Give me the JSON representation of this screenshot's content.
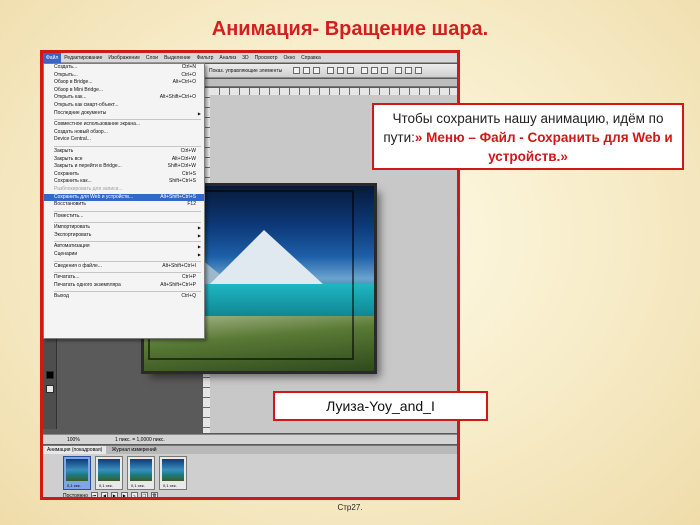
{
  "slide": {
    "title": "Анимация- Вращение шара.",
    "page_number": "Стр27."
  },
  "colors": {
    "accent": "#d01818",
    "menu_highlight": "#3368c8"
  },
  "photoshop": {
    "menubar": [
      "Файл",
      "Редактирование",
      "Изображение",
      "Слои",
      "Выделение",
      "Фильтр",
      "Анализ",
      "3D",
      "Просмотр",
      "Окно",
      "Справка"
    ],
    "options_label": "Показ. управляющие элементы",
    "file_menu": [
      {
        "label": "Создать...",
        "shortcut": "Ctrl+N"
      },
      {
        "label": "Открыть...",
        "shortcut": "Ctrl+O"
      },
      {
        "label": "Обзор в Bridge...",
        "shortcut": "Alt+Ctrl+O"
      },
      {
        "label": "Обзор в Mini Bridge...",
        "shortcut": ""
      },
      {
        "label": "Открыть как...",
        "shortcut": "Alt+Shift+Ctrl+O"
      },
      {
        "label": "Открыть как смарт-объект...",
        "shortcut": ""
      },
      {
        "label": "Последние документы",
        "shortcut": "",
        "submenu": true
      },
      {
        "separator": true
      },
      {
        "label": "Совместное использование экрана...",
        "shortcut": ""
      },
      {
        "label": "Создать новый обзор...",
        "shortcut": ""
      },
      {
        "label": "Device Central...",
        "shortcut": ""
      },
      {
        "separator": true
      },
      {
        "label": "Закрыть",
        "shortcut": "Ctrl+W"
      },
      {
        "label": "Закрыть все",
        "shortcut": "Alt+Ctrl+W"
      },
      {
        "label": "Закрыть и перейти в Bridge...",
        "shortcut": "Shift+Ctrl+W"
      },
      {
        "label": "Сохранить",
        "shortcut": "Ctrl+S"
      },
      {
        "label": "Сохранить как...",
        "shortcut": "Shift+Ctrl+S"
      },
      {
        "label": "Разблокировать для записи...",
        "shortcut": "",
        "disabled": true
      },
      {
        "label": "Сохранить для Web и устройств...",
        "shortcut": "Alt+Shift+Ctrl+S",
        "highlight": true
      },
      {
        "label": "Восстановить",
        "shortcut": "F12"
      },
      {
        "separator": true
      },
      {
        "label": "Поместить...",
        "shortcut": ""
      },
      {
        "separator": true
      },
      {
        "label": "Импортировать",
        "shortcut": "",
        "submenu": true
      },
      {
        "label": "Экспортировать",
        "shortcut": "",
        "submenu": true
      },
      {
        "separator": true
      },
      {
        "label": "Автоматизация",
        "shortcut": "",
        "submenu": true
      },
      {
        "label": "Сценарии",
        "shortcut": "",
        "submenu": true
      },
      {
        "separator": true
      },
      {
        "label": "Сведения о файле...",
        "shortcut": "Alt+Shift+Ctrl+I"
      },
      {
        "separator": true
      },
      {
        "label": "Печатать...",
        "shortcut": "Ctrl+P"
      },
      {
        "label": "Печатать одного экземпляра",
        "shortcut": "Alt+Shift+Ctrl+P"
      },
      {
        "separator": true
      },
      {
        "label": "Выход",
        "shortcut": "Ctrl+Q"
      }
    ],
    "status": {
      "zoom": "100%",
      "info": "1 пикс. = 1,0000 пикс."
    },
    "animation": {
      "tabs": [
        "Анимация (покадровая)",
        "Журнал измерений"
      ],
      "frames": [
        {
          "index": "1",
          "time": "0,1 сек."
        },
        {
          "index": "2",
          "time": "0,1 сек."
        },
        {
          "index": "3",
          "time": "0,1 сек."
        },
        {
          "index": "4",
          "time": "0,1 сек."
        }
      ],
      "loop": "Постоянно"
    }
  },
  "callouts": {
    "instruction_text": "Чтобы сохранить нашу анимацию, идём по пути:",
    "instruction_path": "» Меню – Файл - Сохранить  для Web и устройств.»",
    "author": "Луиза-Yoy_and_I"
  }
}
